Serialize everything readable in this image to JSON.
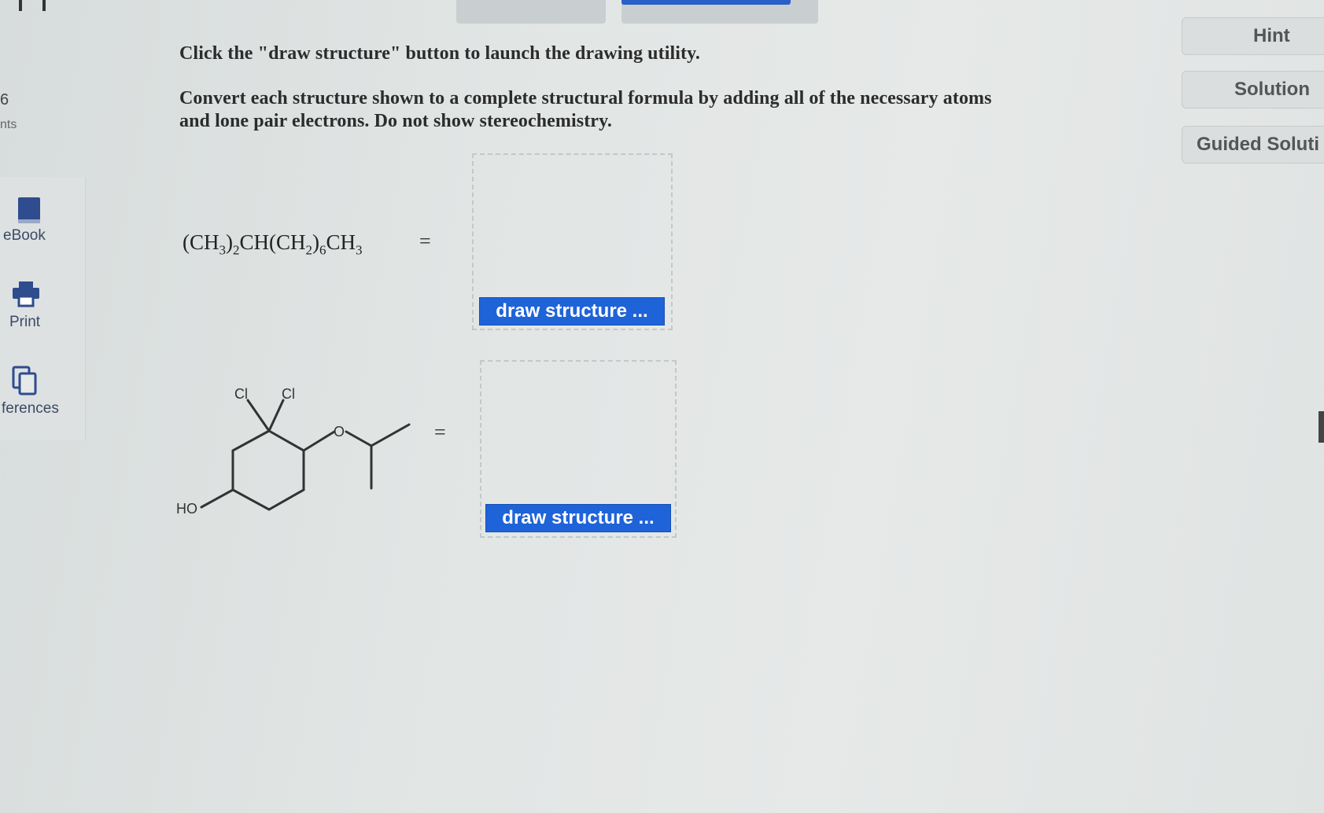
{
  "sidebar": {
    "points_value": "6",
    "points_label": "nts",
    "items": [
      {
        "label": "eBook",
        "icon": "book-icon"
      },
      {
        "label": "Print",
        "icon": "printer-icon"
      },
      {
        "label": "ferences",
        "icon": "references-icon"
      }
    ]
  },
  "instructions": {
    "line1": "Click the \"draw structure\" button to launch the drawing utility.",
    "line2": "Convert each structure shown to a complete structural formula by adding all of the necessary atoms",
    "line3": "and lone pair electrons. Do not show stereochemistry."
  },
  "right_buttons": {
    "hint": "Hint",
    "solution": "Solution",
    "guided": "Guided Soluti"
  },
  "question1": {
    "formula_parts": [
      "(CH",
      "3",
      ")",
      "2",
      "CH(CH",
      "2",
      ")",
      "6",
      "CH",
      "3"
    ],
    "equals": "=",
    "draw_button": "draw structure ..."
  },
  "question2": {
    "atom_labels": {
      "cl1": "Cl",
      "cl2": "Cl",
      "o": "O",
      "ho": "HO"
    },
    "equals": "=",
    "draw_button": "draw structure ..."
  },
  "colors": {
    "accent": "#1f63d8",
    "background": "#e2e6e5"
  }
}
